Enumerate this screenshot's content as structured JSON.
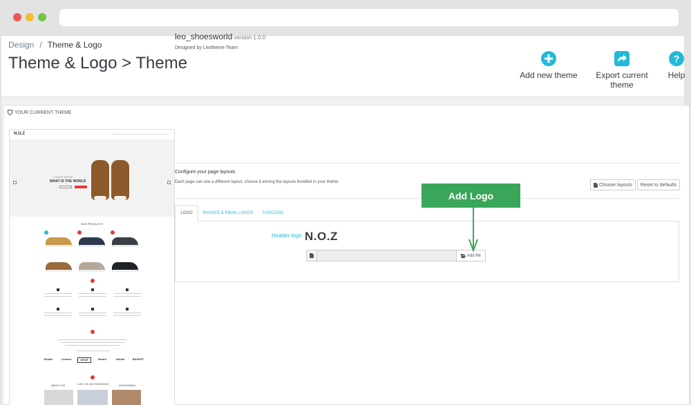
{
  "breadcrumb": {
    "parent": "Design",
    "separator": "/",
    "current": "Theme & Logo"
  },
  "page_title": "Theme & Logo > Theme",
  "toolbar": {
    "add_new_theme": "Add new theme",
    "export_current_theme": "Export current theme",
    "help": "Help"
  },
  "panel": {
    "heading": "YOUR CURRENT THEME",
    "theme_name": "leo_shoesworld",
    "theme_version": "version 1.0.0",
    "author": "Designed by Leotheme Team",
    "config_title": "Configure your page layouts",
    "config_desc": "Each page can use a different layout, choose it among the layouts bundled in your theme.",
    "choose_layouts": "Choose layouts",
    "reset_defaults": "Reset to defaults"
  },
  "tabs": [
    {
      "label": "LOGO",
      "active": true
    },
    {
      "label": "INVOICE & EMAIL LOGOS",
      "active": false
    },
    {
      "label": "FAVICONS",
      "active": false
    }
  ],
  "logo_pane": {
    "header_logo_label": "Header logo",
    "logo_text": "N.O.Z",
    "add_file": "Add file"
  },
  "callout": {
    "label": "Add Logo"
  },
  "preview": {
    "logo": "N.O.Z",
    "hero_line1": "I DONT KNOW",
    "hero_line2": "WHAT IS THE WORLD",
    "section_products": "OUR PRODUCTS",
    "brands": [
      "Readie",
      "Lemont",
      "SHOE",
      "Brand",
      "Infinite",
      "BASKET"
    ],
    "footer_cols": [
      "ABOUT US",
      "LIKE US ON FACEBOOK",
      "INSTAGRAM"
    ]
  },
  "colors": {
    "accent": "#25b9d7",
    "callout_green": "#3aa65a",
    "preview_red": "#e53935"
  }
}
